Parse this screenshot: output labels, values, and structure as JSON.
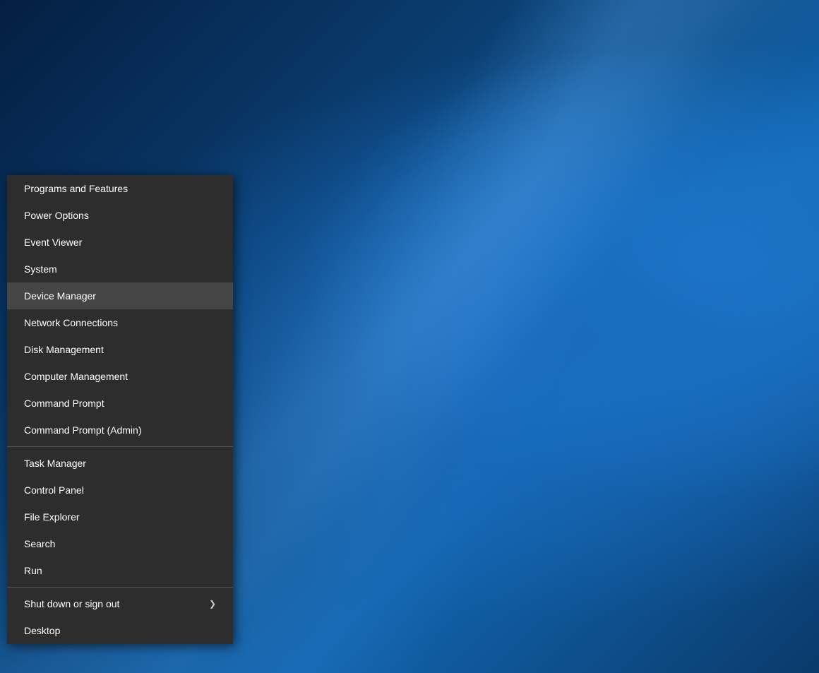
{
  "desktop": {
    "background_description": "Windows 10 blue desktop"
  },
  "context_menu": {
    "items": [
      {
        "id": "programs-and-features",
        "label": "Programs and Features",
        "divider_after": false,
        "chevron": false,
        "highlighted": false
      },
      {
        "id": "power-options",
        "label": "Power Options",
        "divider_after": false,
        "chevron": false,
        "highlighted": false
      },
      {
        "id": "event-viewer",
        "label": "Event Viewer",
        "divider_after": false,
        "chevron": false,
        "highlighted": false
      },
      {
        "id": "system",
        "label": "System",
        "divider_after": false,
        "chevron": false,
        "highlighted": false
      },
      {
        "id": "device-manager",
        "label": "Device Manager",
        "divider_after": false,
        "chevron": false,
        "highlighted": true
      },
      {
        "id": "network-connections",
        "label": "Network Connections",
        "divider_after": false,
        "chevron": false,
        "highlighted": false
      },
      {
        "id": "disk-management",
        "label": "Disk Management",
        "divider_after": false,
        "chevron": false,
        "highlighted": false
      },
      {
        "id": "computer-management",
        "label": "Computer Management",
        "divider_after": false,
        "chevron": false,
        "highlighted": false
      },
      {
        "id": "command-prompt",
        "label": "Command Prompt",
        "divider_after": false,
        "chevron": false,
        "highlighted": false
      },
      {
        "id": "command-prompt-admin",
        "label": "Command Prompt (Admin)",
        "divider_after": true,
        "chevron": false,
        "highlighted": false
      },
      {
        "id": "task-manager",
        "label": "Task Manager",
        "divider_after": false,
        "chevron": false,
        "highlighted": false
      },
      {
        "id": "control-panel",
        "label": "Control Panel",
        "divider_after": false,
        "chevron": false,
        "highlighted": false
      },
      {
        "id": "file-explorer",
        "label": "File Explorer",
        "divider_after": false,
        "chevron": false,
        "highlighted": false
      },
      {
        "id": "search",
        "label": "Search",
        "divider_after": false,
        "chevron": false,
        "highlighted": false
      },
      {
        "id": "run",
        "label": "Run",
        "divider_after": true,
        "chevron": false,
        "highlighted": false
      },
      {
        "id": "shut-down-or-sign-out",
        "label": "Shut down or sign out",
        "divider_after": false,
        "chevron": true,
        "highlighted": false
      },
      {
        "id": "desktop",
        "label": "Desktop",
        "divider_after": false,
        "chevron": false,
        "highlighted": false
      }
    ]
  }
}
